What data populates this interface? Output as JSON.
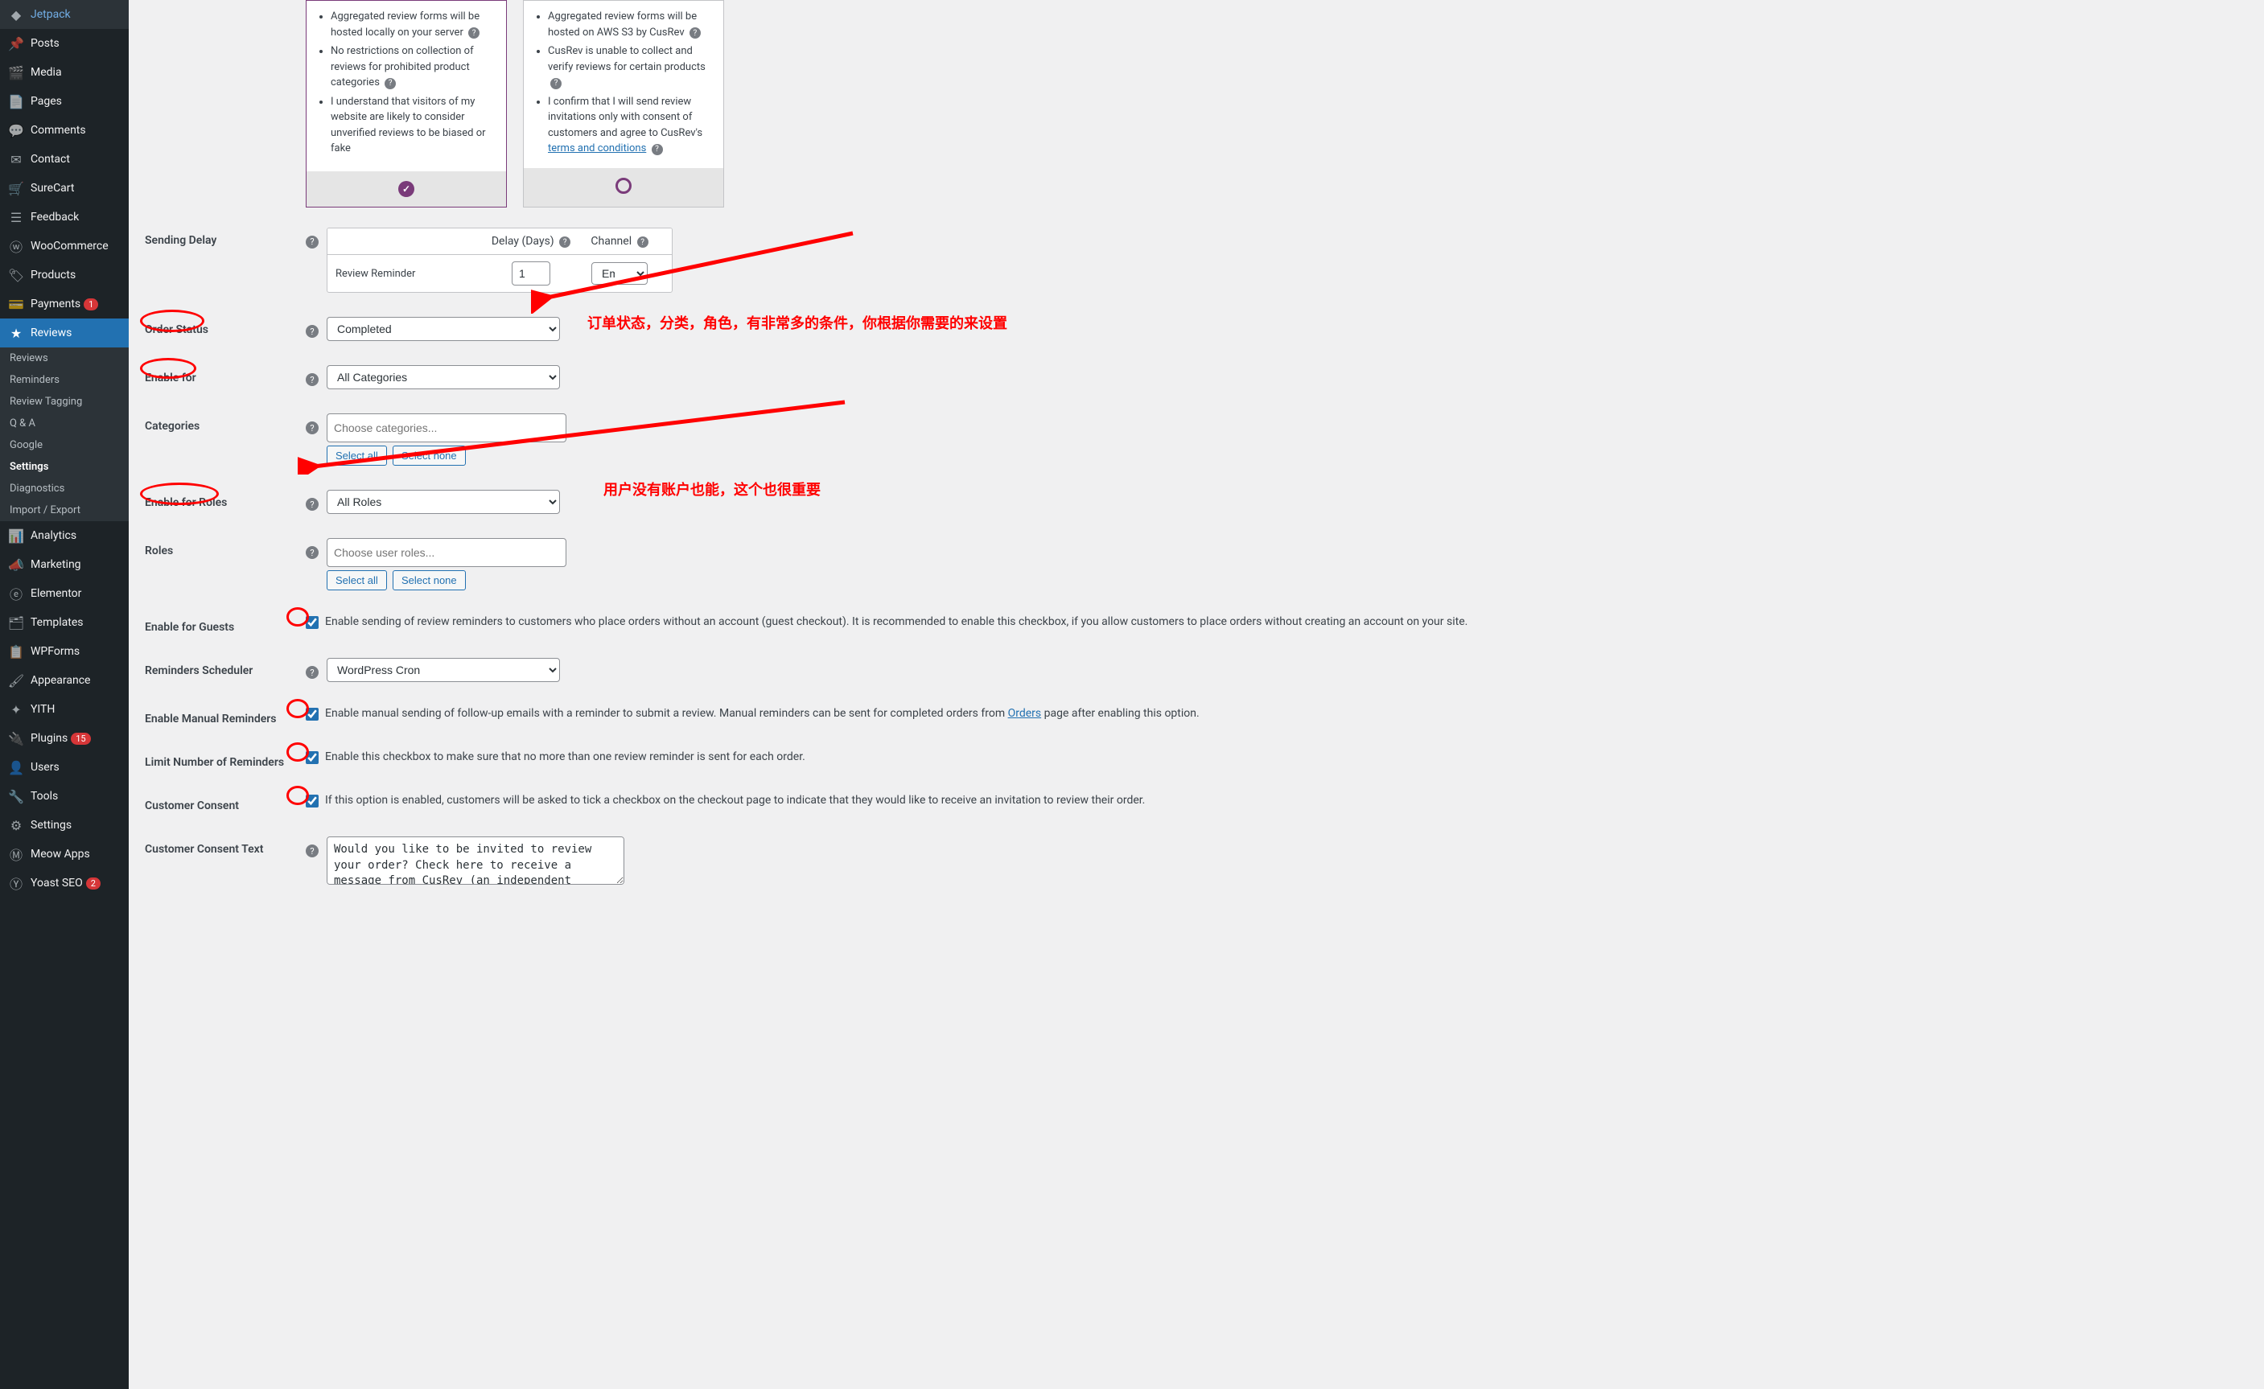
{
  "sidebar": {
    "items": [
      {
        "icon": "jetpack",
        "label": "Jetpack"
      },
      {
        "icon": "pin",
        "label": "Posts"
      },
      {
        "icon": "media",
        "label": "Media"
      },
      {
        "icon": "page",
        "label": "Pages"
      },
      {
        "icon": "comment",
        "label": "Comments"
      },
      {
        "icon": "contact",
        "label": "Contact"
      },
      {
        "icon": "cart",
        "label": "SureCart"
      },
      {
        "icon": "feedback",
        "label": "Feedback"
      },
      {
        "icon": "woo",
        "label": "WooCommerce"
      },
      {
        "icon": "products",
        "label": "Products"
      },
      {
        "icon": "payments",
        "label": "Payments",
        "badge": "1"
      },
      {
        "icon": "star",
        "label": "Reviews",
        "active": true
      }
    ],
    "sub": [
      {
        "label": "Reviews"
      },
      {
        "label": "Reminders"
      },
      {
        "label": "Review Tagging"
      },
      {
        "label": "Q & A"
      },
      {
        "label": "Google"
      },
      {
        "label": "Settings",
        "active": true
      },
      {
        "label": "Diagnostics"
      },
      {
        "label": "Import / Export"
      }
    ],
    "items2": [
      {
        "icon": "analytics",
        "label": "Analytics"
      },
      {
        "icon": "marketing",
        "label": "Marketing"
      },
      {
        "icon": "elementor",
        "label": "Elementor"
      },
      {
        "icon": "templates",
        "label": "Templates"
      },
      {
        "icon": "wpforms",
        "label": "WPForms"
      },
      {
        "icon": "appearance",
        "label": "Appearance"
      },
      {
        "icon": "yith",
        "label": "YITH"
      },
      {
        "icon": "plugins",
        "label": "Plugins",
        "badge": "15"
      },
      {
        "icon": "users",
        "label": "Users"
      },
      {
        "icon": "tools",
        "label": "Tools"
      },
      {
        "icon": "settings",
        "label": "Settings"
      },
      {
        "icon": "meow",
        "label": "Meow Apps"
      },
      {
        "icon": "yoast",
        "label": "Yoast SEO",
        "badge": "2"
      }
    ]
  },
  "cards": {
    "left": {
      "bullets": [
        "Aggregated review forms will be hosted locally on your server",
        "No restrictions on collection of reviews for prohibited product categories",
        "I understand that visitors of my website are likely to consider unverified reviews to be biased or fake"
      ]
    },
    "right": {
      "bullets": [
        "Aggregated review forms will be hosted on AWS S3 by CusRev",
        "CusRev is unable to collect and verify reviews for certain products",
        "I confirm that I will send review invitations only with consent of customers and agree to CusRev's "
      ],
      "terms_link": "terms and conditions"
    }
  },
  "labels": {
    "sending_delay": "Sending Delay",
    "delay_days": "Delay (Days)",
    "channel": "Channel",
    "review_reminder": "Review Reminder",
    "delay_value": "1",
    "channel_value": "Email",
    "order_status": "Order Status",
    "order_status_value": "Completed",
    "enable_for": "Enable for",
    "enable_for_value": "All Categories",
    "categories": "Categories",
    "categories_placeholder": "Choose categories...",
    "select_all": "Select all",
    "select_none": "Select none",
    "enable_for_roles": "Enable for Roles",
    "enable_for_roles_value": "All Roles",
    "roles": "Roles",
    "roles_placeholder": "Choose user roles...",
    "enable_for_guests": "Enable for Guests",
    "guests_desc": "Enable sending of review reminders to customers who place orders without an account (guest checkout). It is recommended to enable this checkbox, if you allow customers to place orders without creating an account on your site.",
    "reminders_scheduler": "Reminders Scheduler",
    "scheduler_value": "WordPress Cron",
    "enable_manual": "Enable Manual Reminders",
    "manual_desc_1": "Enable manual sending of follow-up emails with a reminder to submit a review. Manual reminders can be sent for completed orders from ",
    "manual_link": "Orders",
    "manual_desc_2": " page after enabling this option.",
    "limit_number": "Limit Number of Reminders",
    "limit_desc": "Enable this checkbox to make sure that no more than one review reminder is sent for each order.",
    "customer_consent": "Customer Consent",
    "consent_desc": "If this option is enabled, customers will be asked to tick a checkbox on the checkout page to indicate that they would like to receive an invitation to review their order.",
    "consent_text": "Customer Consent Text",
    "consent_textarea": "Would you like to be invited to review your order? Check here to receive a message from CusRev (an independent reviews service) with a review form."
  },
  "annotations": {
    "text1": "订单状态，分类，角色，有非常多的条件，你根据你需要的来设置",
    "text2": "用户没有账户也能，这个也很重要"
  }
}
